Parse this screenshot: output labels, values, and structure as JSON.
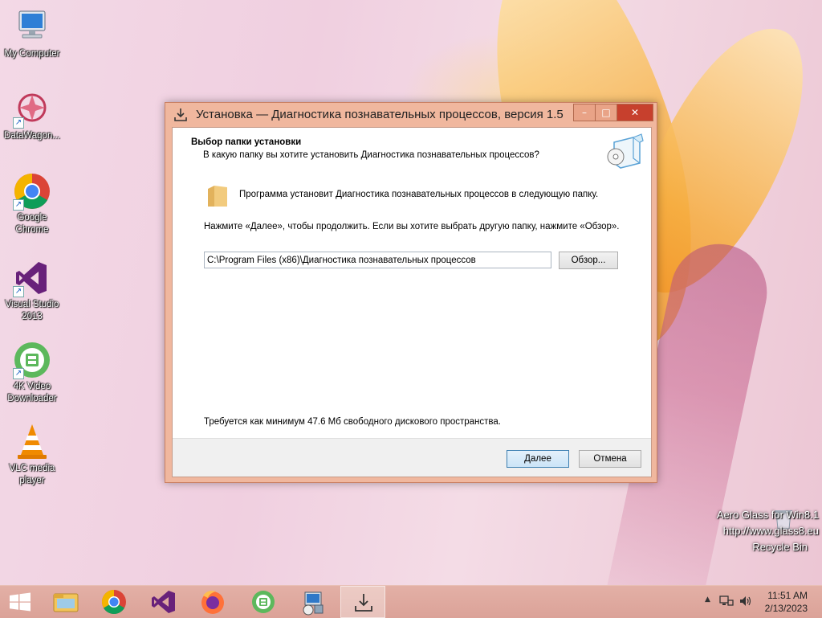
{
  "desktop": {
    "icons": [
      {
        "label": "My Computer"
      },
      {
        "label": "DataWagon..."
      },
      {
        "label": "Google Chrome"
      },
      {
        "label": "Visual Studio 2013"
      },
      {
        "label": "4K Video Downloader"
      },
      {
        "label": "VLC media player"
      }
    ],
    "aero_line1": "Aero Glass for Win8.1",
    "aero_line2": "http://www.glass8.eu",
    "recycle_label": "Recycle Bin"
  },
  "window": {
    "title": "Установка — Диагностика познавательных процессов, версия 1.5",
    "minimize": "–",
    "maximize": "□",
    "close": "✕",
    "header_title": "Выбор папки установки",
    "header_subtitle": "В какую папку вы хотите установить Диагностика познавательных процессов?",
    "info_text": "Программа установит Диагностика познавательных процессов в следующую папку.",
    "instruction_text": "Нажмите «Далее», чтобы продолжить. Если вы хотите выбрать другую папку, нажмите «Обзор».",
    "path_value": "C:\\Program Files (x86)\\Диагностика познавательных процессов",
    "browse_label": "Обзор...",
    "space_text": "Требуется как минимум 47.6 Мб свободного дискового пространства.",
    "next_label": "Далее",
    "cancel_label": "Отмена"
  },
  "taskbar": {
    "time": "11:51 AM",
    "date": "2/13/2023",
    "up_arrow": "▲"
  },
  "colors": {
    "window_frame": "#f0b79e",
    "close_button": "#c7402d",
    "taskbar": "#dba298"
  }
}
